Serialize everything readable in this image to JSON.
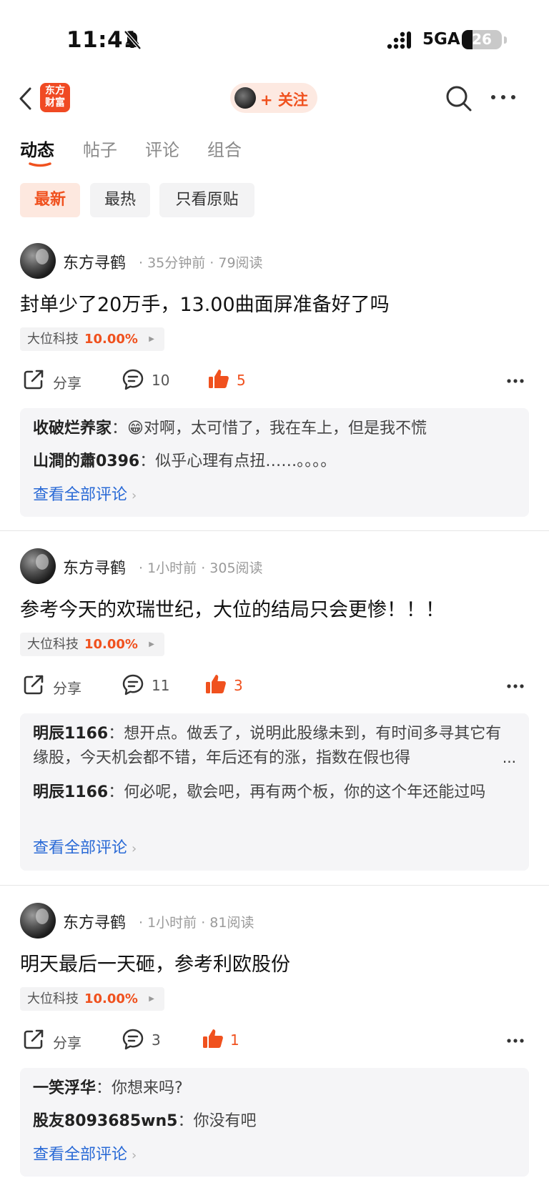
{
  "status_bar": {
    "time": "11:41",
    "network": "5GA",
    "battery": "26",
    "battery_level": 0.26
  },
  "header": {
    "logo_line1": "东方",
    "logo_line2": "财富",
    "follow_label": "+ 关注"
  },
  "tabs": [
    {
      "label": "动态",
      "active": true
    },
    {
      "label": "帖子",
      "active": false
    },
    {
      "label": "评论",
      "active": false
    },
    {
      "label": "组合",
      "active": false
    }
  ],
  "filters": [
    {
      "label": "最新",
      "active": true
    },
    {
      "label": "最热",
      "active": false
    },
    {
      "label": "只看原贴",
      "active": false
    }
  ],
  "posts": [
    {
      "author": "东方寻鹤",
      "meta": "· 35分钟前 · 79阅读",
      "text": "封单少了20万手，13.00曲面屏准备好了吗",
      "stock_name": "大位科技",
      "stock_change": "10.00%",
      "share_label": "分享",
      "comment_count": "10",
      "like_count": "5",
      "comments": [
        {
          "name": "收破烂养家",
          "sep": "：",
          "text": "😁对啊，太可惜了，我在车上，但是我不慌"
        },
        {
          "name": "山澗的蕭0396",
          "sep": "：",
          "text": "似乎心理有点扭……。。。。"
        }
      ],
      "view_all": "查看全部评论"
    },
    {
      "author": "东方寻鹤",
      "meta": "· 1小时前 · 305阅读",
      "text": "参考今天的欢瑞世纪，大位的结局只会更惨！！！",
      "stock_name": "大位科技",
      "stock_change": "10.00%",
      "share_label": "分享",
      "comment_count": "11",
      "like_count": "3",
      "comments": [
        {
          "name": "明辰1166",
          "sep": "：",
          "text": "想开点。做丢了，说明此股缘未到，有时间多寻其它有缘股，今天机会都不错，年后还有的涨，指数在假也得"
        },
        {
          "name": "明辰1166",
          "sep": "：",
          "text": "何必呢，歇会吧，再有两个板，你的这个年还能过吗"
        }
      ],
      "ellipsis": "...",
      "view_all": "查看全部评论"
    },
    {
      "author": "东方寻鹤",
      "meta": "· 1小时前 · 81阅读",
      "text": "明天最后一天砸，参考利欧股份",
      "stock_name": "大位科技",
      "stock_change": "10.00%",
      "share_label": "分享",
      "comment_count": "3",
      "like_count": "1",
      "comments": [
        {
          "name": "一笑浮华",
          "sep": "：",
          "text": "你想来吗?"
        },
        {
          "name": "股友8093685wn5",
          "sep": "：",
          "text": "你没有吧"
        }
      ],
      "view_all": "查看全部评论"
    }
  ],
  "colors": {
    "accent": "#f0511e",
    "link": "#2a6ad6",
    "logo": "#f04a23"
  }
}
